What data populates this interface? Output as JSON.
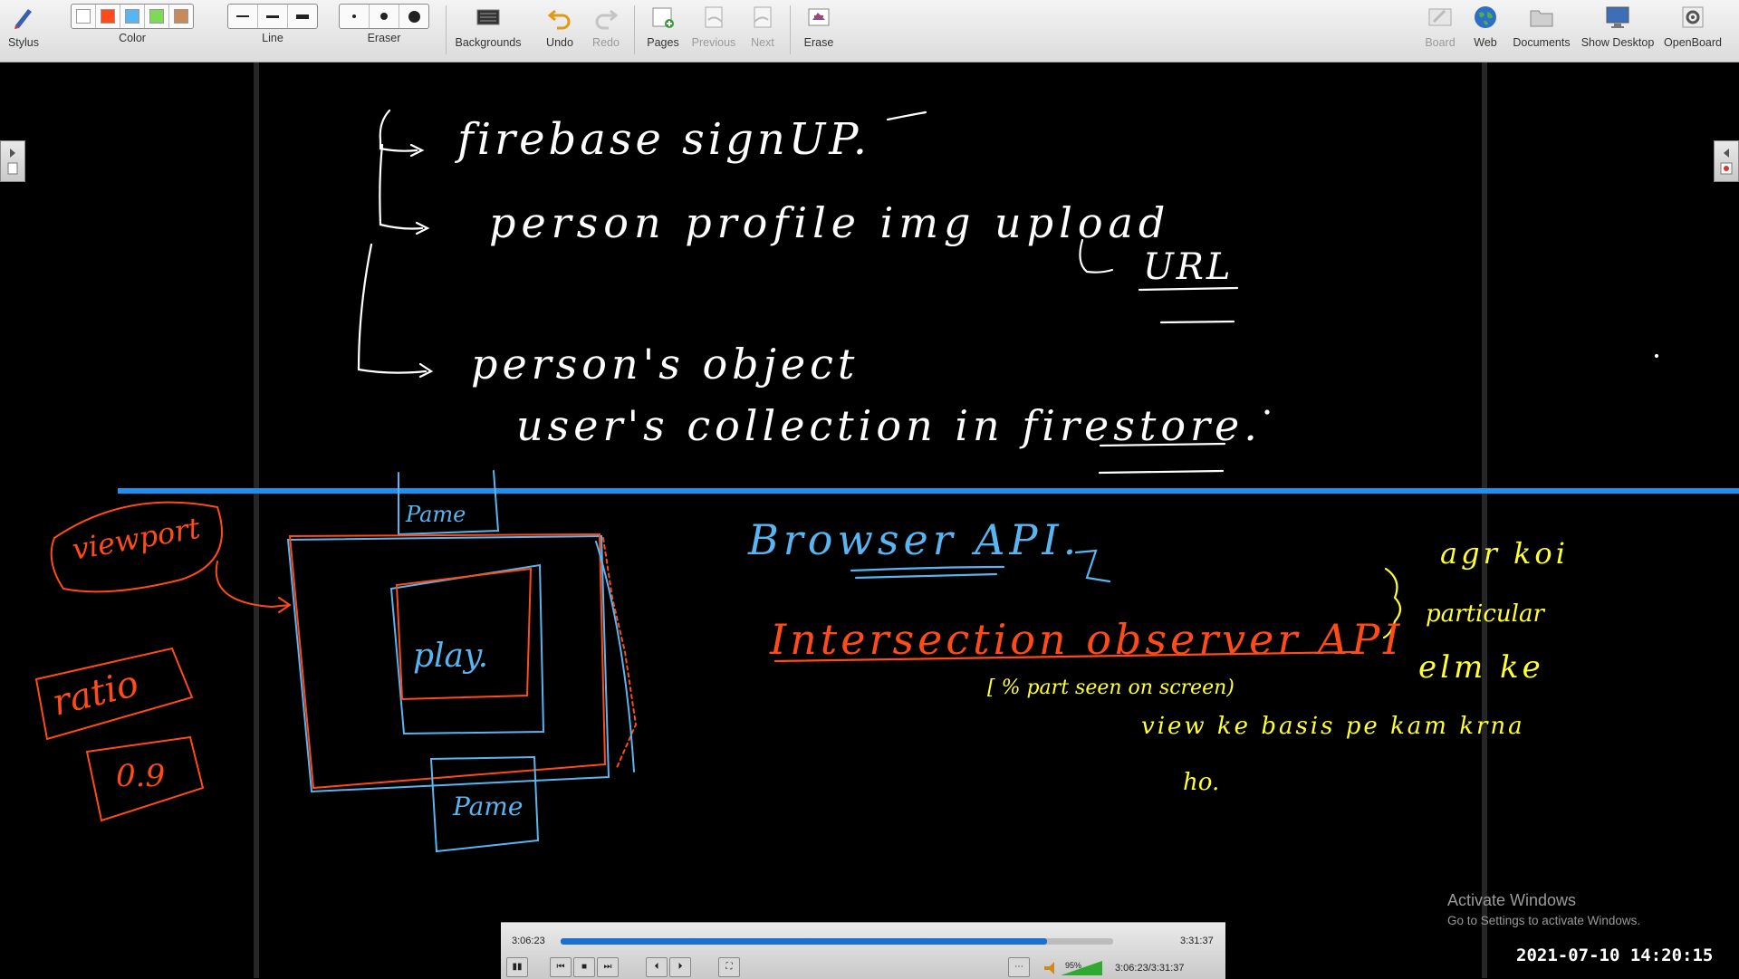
{
  "toolbar": {
    "stylus": "Stylus",
    "color": "Color",
    "line": "Line",
    "eraser": "Eraser",
    "backgrounds": "Backgrounds",
    "undo": "Undo",
    "redo": "Redo",
    "pages": "Pages",
    "previous": "Previous",
    "next": "Next",
    "erase": "Erase",
    "board": "Board",
    "web": "Web",
    "documents": "Documents",
    "show_desktop": "Show Desktop",
    "openboard": "OpenBoard",
    "colors": [
      "#ffffff",
      "#ff4a1a",
      "#5ab4f0",
      "#7ed957",
      "#c98a5a"
    ]
  },
  "notes": {
    "line1": "firebase signUP.",
    "line2": "person profile img upload",
    "line3": "URL",
    "line4": "person's object",
    "line5": "user's collection in firestore.",
    "viewport": "viewport",
    "ratio": "ratio",
    "ratio_value": "0.9",
    "frame_top": "Pame",
    "frame_center": "play.",
    "frame_bottom": "Pame",
    "browser_api": "Browser API.",
    "intersection": "Intersection observer API",
    "percent_seen": "[ % part seen on screen)",
    "hinglish_1": "agr koi",
    "hinglish_2": "particular",
    "hinglish_3": "elm ke",
    "hinglish_4": "view ke basis pe kam krna",
    "hinglish_5": "ho."
  },
  "player": {
    "elapsed": "3:06:23",
    "total": "3:31:37",
    "progress": 0.88,
    "volume": "95%",
    "position_readout": "3:06:23/3:31:37"
  },
  "watermark": {
    "title": "Activate Windows",
    "subtitle": "Go to Settings to activate Windows."
  },
  "datetime": "2021-07-10  14:20:15"
}
